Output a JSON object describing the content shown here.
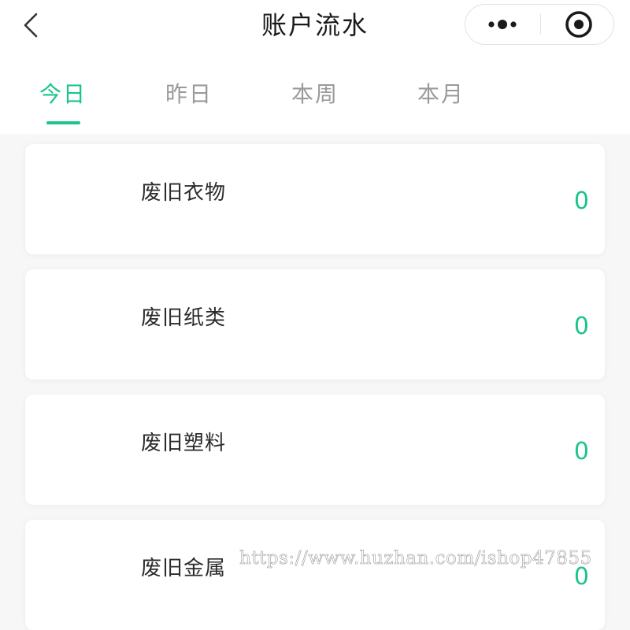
{
  "navbar": {
    "title": "账户流水"
  },
  "tabs": [
    {
      "label": "今日",
      "active": true
    },
    {
      "label": "昨日",
      "active": false
    },
    {
      "label": "本周",
      "active": false
    },
    {
      "label": "本月",
      "active": false
    }
  ],
  "items": [
    {
      "label": "废旧衣物",
      "value": "0"
    },
    {
      "label": "废旧纸类",
      "value": "0"
    },
    {
      "label": "废旧塑料",
      "value": "0"
    },
    {
      "label": "废旧金属",
      "value": "0"
    }
  ],
  "watermark": "https://www.huzhan.com/ishop47855",
  "colors": {
    "accent": "#1cc48c",
    "tab_inactive": "#9a9a9a",
    "text": "#2b2b2b",
    "background": "#f7f7f7"
  },
  "icons": {
    "back": "chevron-left-icon",
    "more": "more-dots-icon",
    "close": "target-circle-icon"
  }
}
